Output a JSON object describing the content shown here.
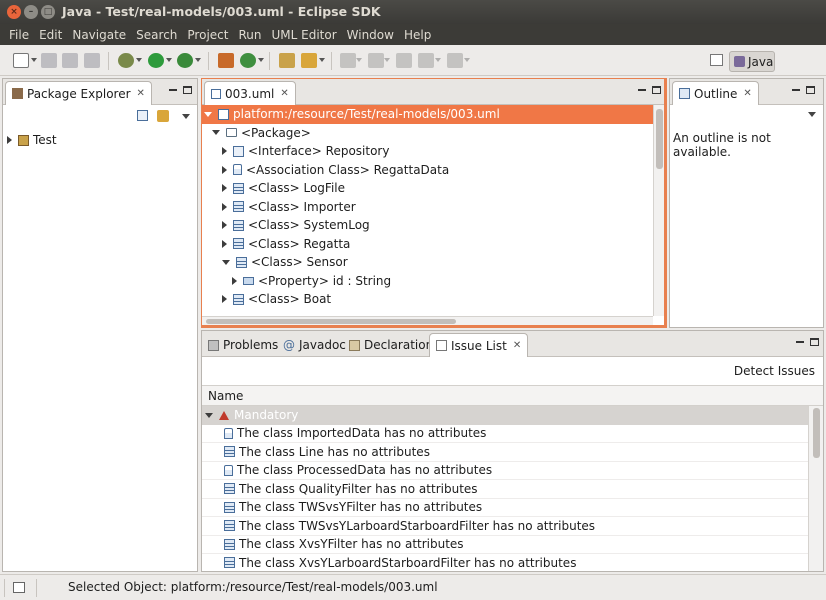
{
  "window": {
    "title": "Java - Test/real-models/003.uml - Eclipse SDK"
  },
  "menu": [
    "File",
    "Edit",
    "Navigate",
    "Search",
    "Project",
    "Run",
    "UML Editor",
    "Window",
    "Help"
  ],
  "perspective": {
    "label": "Java"
  },
  "package_explorer": {
    "tab_label": "Package Explorer",
    "tree": [
      {
        "label": "Test"
      }
    ]
  },
  "editor": {
    "tab_label": "003.uml",
    "rows": [
      {
        "label": "platform:/resource/Test/real-models/003.uml",
        "icon": "model-icon"
      },
      {
        "label": "<Package>",
        "icon": "package-icon"
      },
      {
        "label": "<Interface> Repository",
        "icon": "interface-icon"
      },
      {
        "label": "<Association Class> RegattaData",
        "icon": "association-class-icon"
      },
      {
        "label": "<Class> LogFile",
        "icon": "class-icon"
      },
      {
        "label": "<Class> Importer",
        "icon": "class-icon"
      },
      {
        "label": "<Class> SystemLog",
        "icon": "class-icon"
      },
      {
        "label": "<Class> Regatta",
        "icon": "class-icon"
      },
      {
        "label": "<Class> Sensor",
        "icon": "class-icon"
      },
      {
        "label": "<Property> id : String",
        "icon": "property-icon"
      },
      {
        "label": "<Class> Boat",
        "icon": "class-icon"
      }
    ],
    "colors": {
      "selection": "#f07746",
      "border": "#e8804f"
    }
  },
  "outline": {
    "tab_label": "Outline",
    "message": "An outline is not available."
  },
  "bottom_panel": {
    "tabs": [
      "Problems",
      "Javadoc",
      "Declaration",
      "Issue List"
    ],
    "active_tab": "Issue List",
    "detect_label": "Detect Issues",
    "column_header": "Name",
    "group_label": "Mandatory",
    "issues": [
      {
        "label": "The class ImportedData has no attributes",
        "icon": "association-class-icon"
      },
      {
        "label": "The class Line has no attributes",
        "icon": "class-icon"
      },
      {
        "label": "The class ProcessedData has no attributes",
        "icon": "association-class-icon"
      },
      {
        "label": "The class QualityFilter has no attributes",
        "icon": "class-icon"
      },
      {
        "label": "The class TWSvsYFilter has no attributes",
        "icon": "class-icon"
      },
      {
        "label": "The class TWSvsYLarboardStarboardFilter has no attributes",
        "icon": "class-icon"
      },
      {
        "label": "The class XvsYFilter has no attributes",
        "icon": "class-icon"
      },
      {
        "label": "The class XvsYLarboardStarboardFilter has no attributes",
        "icon": "class-icon"
      }
    ]
  },
  "status": {
    "text": "Selected Object: platform:/resource/Test/real-models/003.uml"
  }
}
